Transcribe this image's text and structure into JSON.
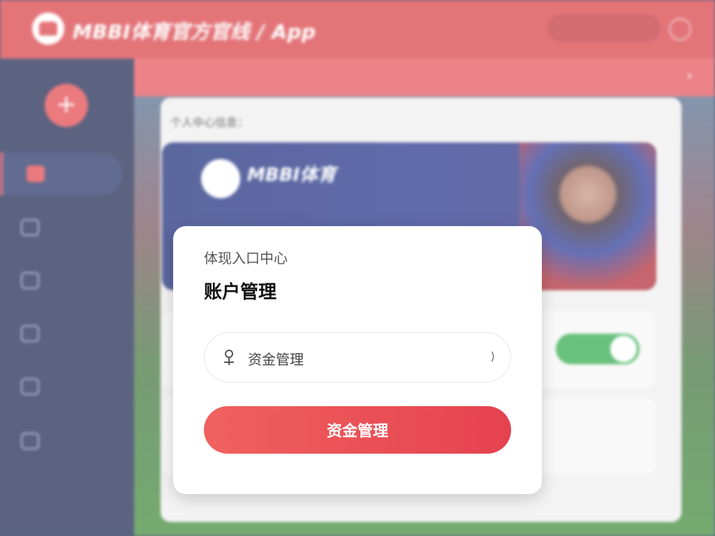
{
  "header": {
    "brand": "MBBI体育官方官线 / App",
    "lang_pill": "",
    "phone_icon": "phone-icon"
  },
  "notice": {
    "left": "",
    "right": ""
  },
  "sidebar": {
    "plus_label": "+",
    "items": [
      {
        "label": "",
        "active": true
      },
      {
        "label": ""
      },
      {
        "label": ""
      },
      {
        "label": ""
      },
      {
        "label": ""
      },
      {
        "label": ""
      }
    ]
  },
  "content": {
    "section_title": "个人中心信息：",
    "banner_brand": "MBBI体育",
    "banner_sub": "",
    "row2_text": ""
  },
  "modal": {
    "subtitle": "体现入口中心",
    "title": "账户管理",
    "description": "",
    "select_value": "资金管理",
    "select_icon": "user-icon",
    "chevron_icon": "chevron-down-icon",
    "submit_label": "资金管理",
    "footer_normal": "",
    "footer_warning": "",
    "footer_link": ""
  },
  "colors": {
    "brand_red": "#d94046",
    "sidebar_navy": "#1c2750",
    "button_gradient_start": "#f0615e",
    "button_gradient_end": "#e5424f",
    "toggle_green": "#2faa4a"
  }
}
